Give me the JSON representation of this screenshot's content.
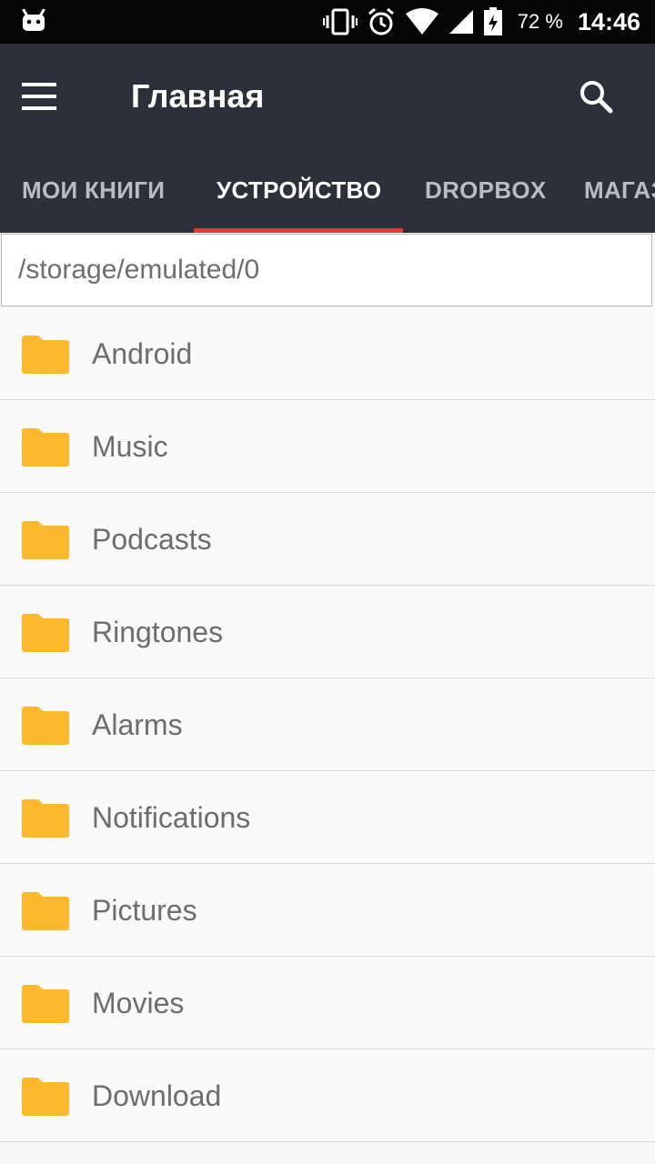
{
  "status_bar": {
    "battery_percent": "72 %",
    "time": "14:46"
  },
  "app_bar": {
    "title": "Главная"
  },
  "tabs": [
    {
      "label": "МОИ КНИГИ",
      "active": false
    },
    {
      "label": "УСТРОЙСТВО",
      "active": true
    },
    {
      "label": "DROPBOX",
      "active": false
    },
    {
      "label": "МАГАЗИН",
      "active": false
    }
  ],
  "path": "/storage/emulated/0",
  "folders": [
    {
      "name": "Android"
    },
    {
      "name": "Music"
    },
    {
      "name": "Podcasts"
    },
    {
      "name": "Ringtones"
    },
    {
      "name": "Alarms"
    },
    {
      "name": "Notifications"
    },
    {
      "name": "Pictures"
    },
    {
      "name": "Movies"
    },
    {
      "name": "Download"
    }
  ],
  "colors": {
    "app_bar": "#2e3039",
    "tab_indicator": "#e53935",
    "folder": "#fdb92e"
  }
}
